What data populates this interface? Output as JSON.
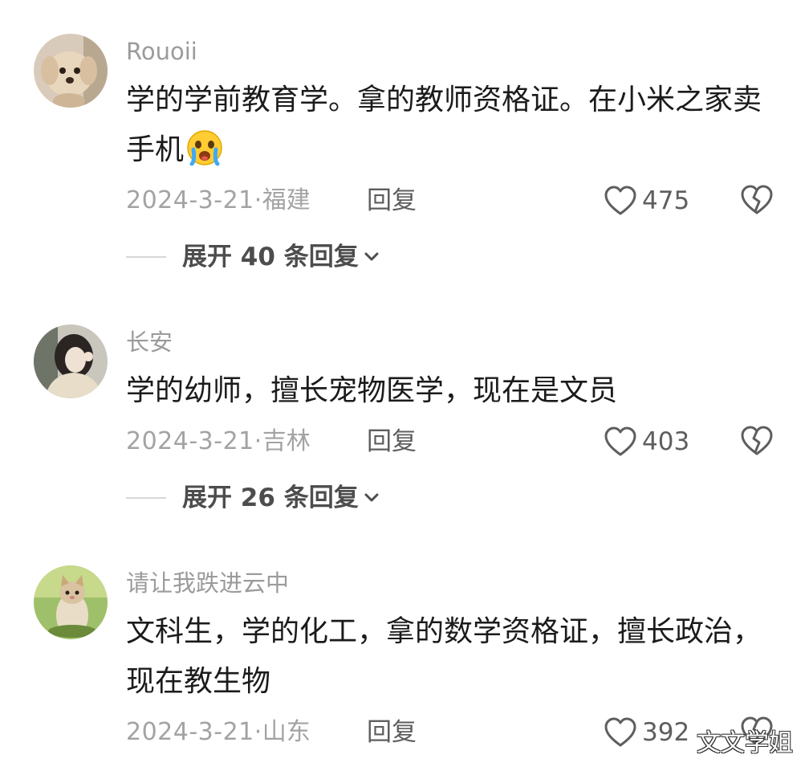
{
  "comments": [
    {
      "username": "Rouoii",
      "text": "学的学前教育学。拿的教师资格证。在小米之家卖手机",
      "emoji_icon": "crying-face-emoji",
      "date": "2024-3-21·",
      "location": "福建",
      "reply_label": "回复",
      "like_count": "475",
      "expand_label": "展开 40 条回复"
    },
    {
      "username": "长安",
      "text": "学的幼师，擅长宠物医学，现在是文员",
      "date": "2024-3-21·",
      "location": "吉林",
      "reply_label": "回复",
      "like_count": "403",
      "expand_label": "展开 26 条回复"
    },
    {
      "username": "请让我跌进云中",
      "text": "文科生，学的化工，拿的数学资格证，擅长政治，现在教生物",
      "date": "2024-3-21·",
      "location": "山东",
      "reply_label": "回复",
      "like_count": "392"
    }
  ],
  "watermark": "文文学姐"
}
